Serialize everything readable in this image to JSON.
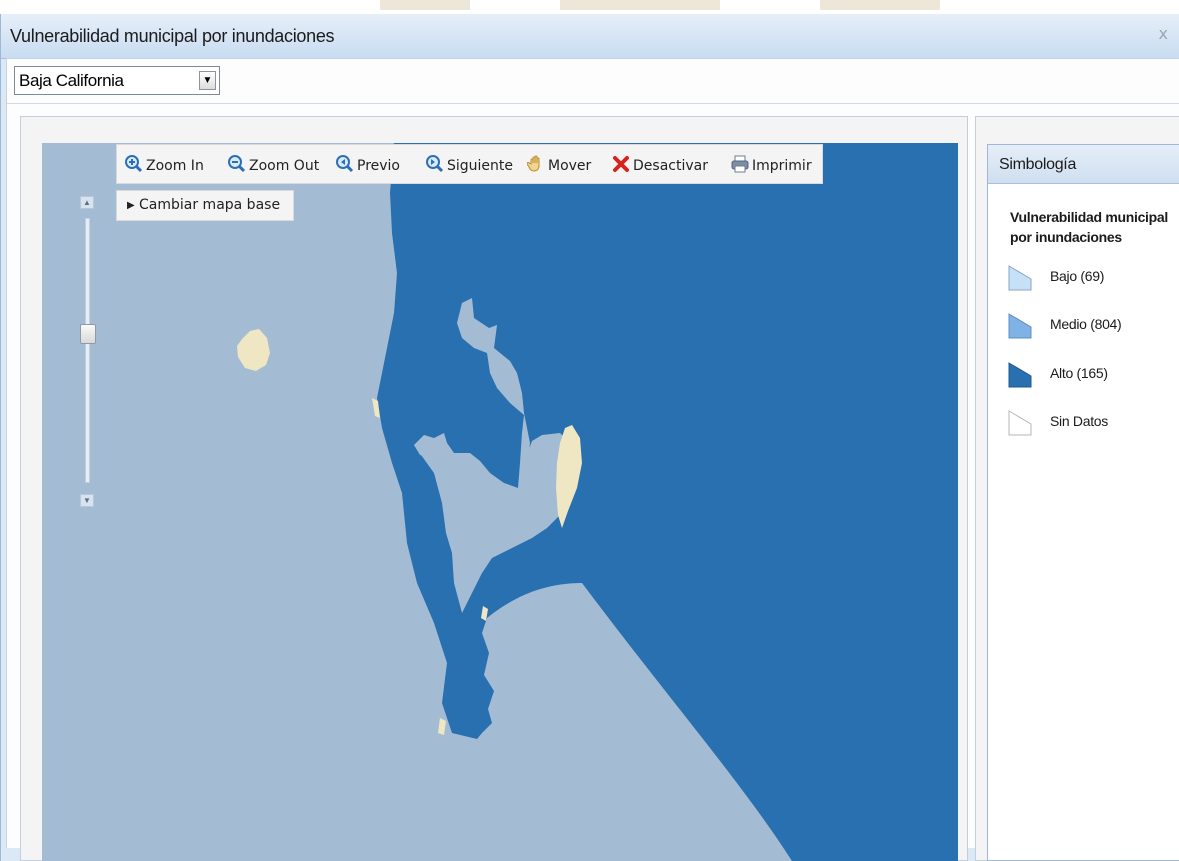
{
  "window": {
    "title": "Vulnerabilidad municipal por inundaciones",
    "close_label": "x"
  },
  "state_select": {
    "selected": "Baja California"
  },
  "toolbar": {
    "zoom_in": "Zoom In",
    "zoom_out": "Zoom Out",
    "previous": "Previo",
    "next": "Siguiente",
    "pan": "Mover",
    "deactivate": "Desactivar",
    "print": "Imprimir"
  },
  "basemap": {
    "label": "Cambiar mapa base"
  },
  "legend": {
    "header": "Simbología",
    "title": "Vulnerabilidad municipal por inundaciones",
    "items": [
      {
        "label": "Bajo (69)",
        "color": "#c6e1f7"
      },
      {
        "label": "Medio (804)",
        "color": "#7fb2e5"
      },
      {
        "label": "Alto (165)",
        "color": "#2870b0"
      },
      {
        "label": "Sin Datos",
        "color": "#ffffff"
      }
    ]
  },
  "map": {
    "water_color": "#a3bcd4",
    "municipality_color": "#2870b0",
    "land_color": "#efe6c3"
  }
}
